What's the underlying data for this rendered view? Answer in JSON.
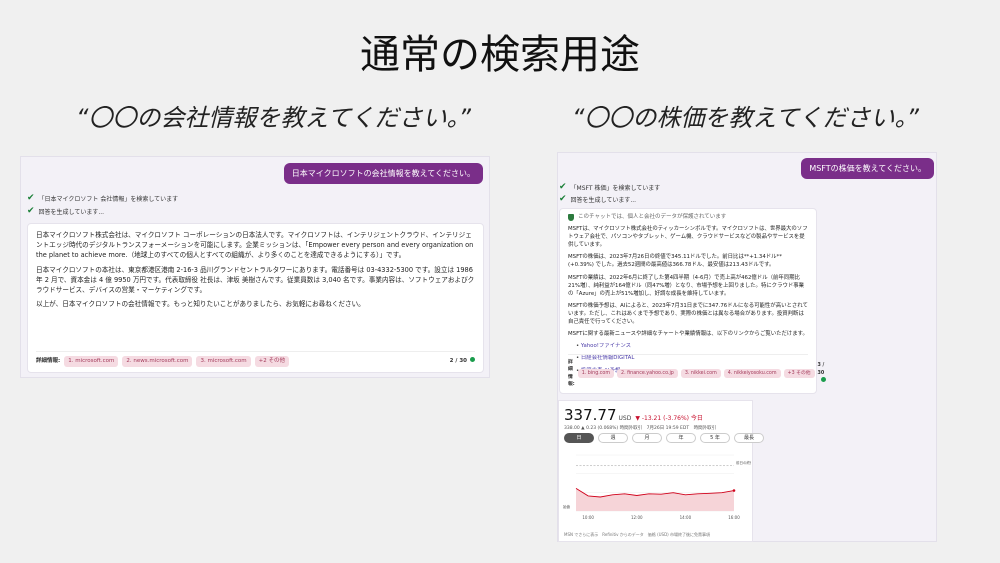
{
  "slide_title": "通常の検索用途",
  "left": {
    "caption": "“〇〇の会社情報を教えてください。”",
    "user_message": "日本マイクロソフトの会社情報を教えてください。",
    "status1": "「日本マイクロソフト 会社情報」を検索しています",
    "status2": "回答を生成しています...",
    "para1": "日本マイクロソフト株式会社は、マイクロソフト コーポレーションの日本法人です。マイクロソフトは、インテリジェントクラウド、インテリジェントエッジ時代のデジタルトランスフォーメーションを可能にします。企業ミッションは、「Empower every person and every organization on the planet to achieve more.（地球上のすべての個人とすべての組織が、より多くのことを達成できるようにする）」です。",
    "para2": "日本マイクロソフトの本社は、東京都港区港南 2-16-3 品川グランドセントラルタワーにあります。電話番号は 03-4332-5300 です。設立は 1986 年 2 月で、資本金は 4 億 9950 万円です。代表取締役 社長は、津坂 美樹さんです。従業員数は 3,040 名です。事業内容は、ソフトウェアおよびクラウドサービス、デバイスの営業・マーケティングです。",
    "para3": "以上が、日本マイクロソフトの会社情報です。もっと知りたいことがありましたら、お気軽にお尋ねください。",
    "refs_label": "詳細情報:",
    "refs": [
      "1. microsoft.com",
      "2. news.microsoft.com",
      "3. microsoft.com",
      "+2 その他"
    ],
    "count": "2 / 30"
  },
  "right": {
    "caption": "“〇〇の株価を教えてください。”",
    "user_message": "MSFTの株価を教えてください。",
    "status1": "「MSFT 株価」を検索しています",
    "status2": "回答を生成しています...",
    "notice": "このチャットでは、個人と会社のデータが保護されています",
    "para1": "MSFTは、マイクロソフト株式会社のティッカーシンボルです。マイクロソフトは、世界最大のソフトウェア会社で、パソコンやタブレット、ゲーム機、クラウドサービスなどの製品やサービスを提供しています。",
    "para2": "MSFTの株価は、2023年7月26日の終値で345.11ドルでした。前日比は**+1.34ドル** (+0.39%) でした。過去52週間の最高値は366.78ドル、最安値は213.43ドルです。",
    "para3": "MSFTの業績は、2022年6月に終了した第4四半期（4-6月）で売上高が462億ドル（前年同期比21%増）、純利益が164億ドル（同47%増）となり、市場予想を上回りました。特にクラウド事業の「Azure」の売上が51%増加し、好調な成長を維持しています。",
    "para4": "MSFTの株価予想は、AIによると、2023年7月31日までに347.76ドルになる可能性が高いとされています。ただし、これはあくまで予想であり、実際の株価とは異なる場合があります。投資判断は自己責任で行ってください。",
    "para5": "MSFTに関する最新ニュースや詳細なチャートや業績情報は、以下のリンクからご覧いただけます。",
    "links": [
      "Yahoo!ファイナンス",
      "日経会社情報DIGITAL",
      "投資の森 AI予想"
    ],
    "refs_label": "詳細情報:",
    "refs": [
      "1. bing.com",
      "2. finance.yahoo.co.jp",
      "3. nikkei.com",
      "4. nikkeiyosoku.com",
      "+3 その他"
    ],
    "count": "3 / 30"
  },
  "stock": {
    "price": "337.77",
    "currency": "USD",
    "change": "▼ -13.21 (-3.76%) 今日",
    "sub": "338.00 ▲ 0.23 (0.068%) 時間外取引　7月26日 19:59 EDT　時間外取引",
    "ranges": [
      "日",
      "週",
      "月",
      "年",
      "5 年",
      "最長"
    ],
    "active_range": "日",
    "footer": "MSN でさらに表示　Refinitiv からのデータ　価格 (USD) 市場終了後に免責事項",
    "chart_data": {
      "type": "line",
      "x": [
        "09:30",
        "10:00",
        "10:30",
        "11:00",
        "11:30",
        "12:00",
        "12:30",
        "13:00",
        "13:30",
        "14:00",
        "14:30",
        "15:00",
        "15:30",
        "16:00"
      ],
      "values": [
        340.5,
        337.0,
        336.5,
        337.5,
        338.0,
        337.2,
        338.0,
        337.8,
        338.5,
        337.5,
        338.0,
        338.2,
        338.5,
        339.5
      ],
      "x_ticks": [
        "10:00",
        "12:00",
        "14:00",
        "16:00"
      ],
      "ylim": [
        330,
        356
      ],
      "annotation": "前日の終値 351",
      "open_label": "始値"
    }
  }
}
